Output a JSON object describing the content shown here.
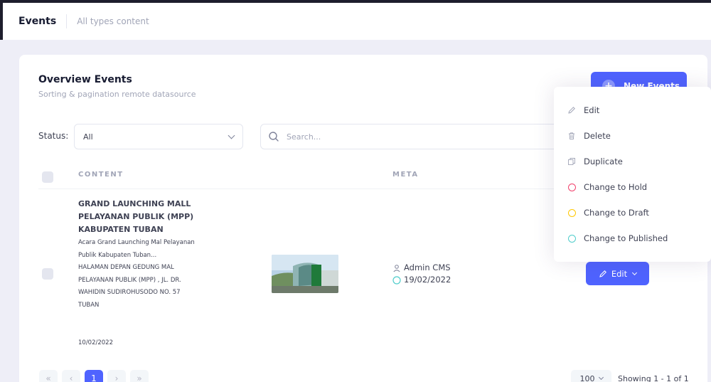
{
  "header": {
    "title": "Events",
    "subtitle": "All types content"
  },
  "card": {
    "title": "Overview Events",
    "subtitle": "Sorting & pagination remote datasource",
    "new_button": "New Events"
  },
  "filters": {
    "status_label": "Status:",
    "status_value": "All",
    "search_placeholder": "Search..."
  },
  "table": {
    "columns": [
      "CONTENT",
      "META"
    ],
    "rows": [
      {
        "title": "GRAND LAUNCHING MALL PELAYANAN PUBLIK (MPP) KABUPATEN TUBAN",
        "description": "Acara Grand Launching Mal Pelayanan Publik Kabupaten Tuban...",
        "location": "HALAMAN DEPAN GEDUNG MAL PELAYANAN PUBLIK (MPP) , JL. DR. WAHIDIN SUDIROHUSODO NO. 57 TUBAN",
        "date": "10/02/2022",
        "author": "Admin CMS",
        "meta_date": "19/02/2022",
        "action_label": "Edit"
      }
    ]
  },
  "pagination": {
    "first": "«",
    "prev": "‹",
    "current": "1",
    "next": "›",
    "last": "»",
    "page_size": "100",
    "showing": "Showing 1 - 1 of 1"
  },
  "dropdown": {
    "items": [
      {
        "label": "Edit",
        "icon": "pencil-icon"
      },
      {
        "label": "Delete",
        "icon": "trash-icon"
      },
      {
        "label": "Duplicate",
        "icon": "copy-icon"
      },
      {
        "label": "Change to Hold",
        "icon": "circle-icon",
        "color": "#f1416c"
      },
      {
        "label": "Change to Draft",
        "icon": "circle-icon",
        "color": "#ffc700"
      },
      {
        "label": "Change to Published",
        "icon": "circle-icon",
        "color": "#50cdcb"
      }
    ]
  },
  "colors": {
    "primary": "#4f63ff",
    "background": "#eeeef7"
  }
}
